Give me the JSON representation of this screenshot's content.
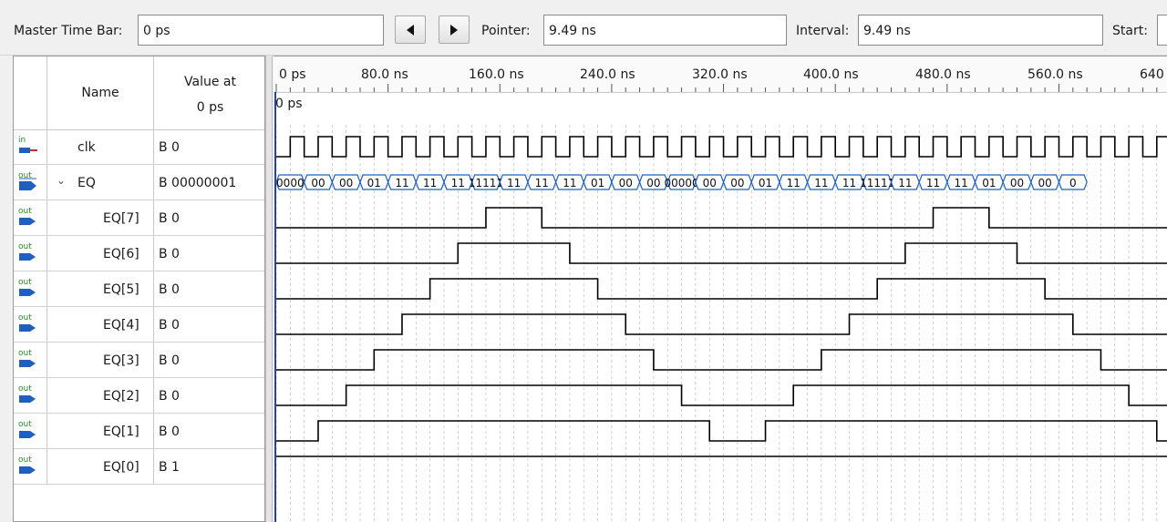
{
  "toolbar": {
    "master_time_bar_label": "Master Time Bar:",
    "master_time_bar_value": "0 ps",
    "pointer_label": "Pointer:",
    "pointer_value": "9.49 ns",
    "interval_label": "Interval:",
    "interval_value": "9.49 ns",
    "start_label": "Start:"
  },
  "signals_panel": {
    "header_name": "Name",
    "header_value_line1": "Value at",
    "header_value_line2": "0 ps",
    "rows": [
      {
        "icon": "in-icon",
        "icon_text": "in",
        "name": "clk",
        "value": "B 0"
      },
      {
        "icon": "out-icon",
        "icon_text": "out",
        "name": "EQ",
        "value": "B 00000001",
        "expanded": true
      },
      {
        "icon": "out-icon",
        "icon_text": "out",
        "name": "EQ[7]",
        "value": "B 0"
      },
      {
        "icon": "out-icon",
        "icon_text": "out",
        "name": "EQ[6]",
        "value": "B 0"
      },
      {
        "icon": "out-icon",
        "icon_text": "out",
        "name": "EQ[5]",
        "value": "B 0"
      },
      {
        "icon": "out-icon",
        "icon_text": "out",
        "name": "EQ[4]",
        "value": "B 0"
      },
      {
        "icon": "out-icon",
        "icon_text": "out",
        "name": "EQ[3]",
        "value": "B 0"
      },
      {
        "icon": "out-icon",
        "icon_text": "out",
        "name": "EQ[2]",
        "value": "B 0"
      },
      {
        "icon": "out-icon",
        "icon_text": "out",
        "name": "EQ[1]",
        "value": "B 0"
      },
      {
        "icon": "out-icon",
        "icon_text": "out",
        "name": "EQ[0]",
        "value": "B 1"
      }
    ]
  },
  "ruler": {
    "ticks": [
      "0 ps",
      "80.0 ns",
      "160.0 ns",
      "240.0 ns",
      "320.0 ns",
      "400.0 ns",
      "480.0 ns",
      "560.0 ns",
      "640"
    ],
    "pointer_time": "0 ps"
  },
  "waveform": {
    "clock_period_ns": 20,
    "bus_labels_visible": [
      "0000",
      "00",
      "00",
      "01",
      "11",
      "11",
      "11",
      "11111",
      "11",
      "11",
      "11",
      "01",
      "00",
      "00",
      "00000",
      "00",
      "00",
      "01",
      "11",
      "11",
      "11",
      "11111",
      "11",
      "11",
      "11",
      "01",
      "00",
      "00",
      "0"
    ],
    "bit_high_intervals_ns": {
      "EQ[7]": [
        [
          150,
          190
        ],
        [
          470,
          510
        ]
      ],
      "EQ[6]": [
        [
          130,
          210
        ],
        [
          450,
          530
        ]
      ],
      "EQ[5]": [
        [
          110,
          230
        ],
        [
          430,
          550
        ]
      ],
      "EQ[4]": [
        [
          90,
          250
        ],
        [
          410,
          570
        ]
      ],
      "EQ[3]": [
        [
          70,
          270
        ],
        [
          390,
          590
        ]
      ],
      "EQ[2]": [
        [
          50,
          290
        ],
        [
          370,
          610
        ]
      ],
      "EQ[1]": [
        [
          30,
          310
        ],
        [
          350,
          630
        ]
      ],
      "EQ[0]": [
        [
          0,
          640
        ]
      ]
    },
    "colors": {
      "bus": "#1f5fbf",
      "grid": "#b0b0b0",
      "cursor": "#2a3fa8",
      "signal": "#000000"
    }
  }
}
